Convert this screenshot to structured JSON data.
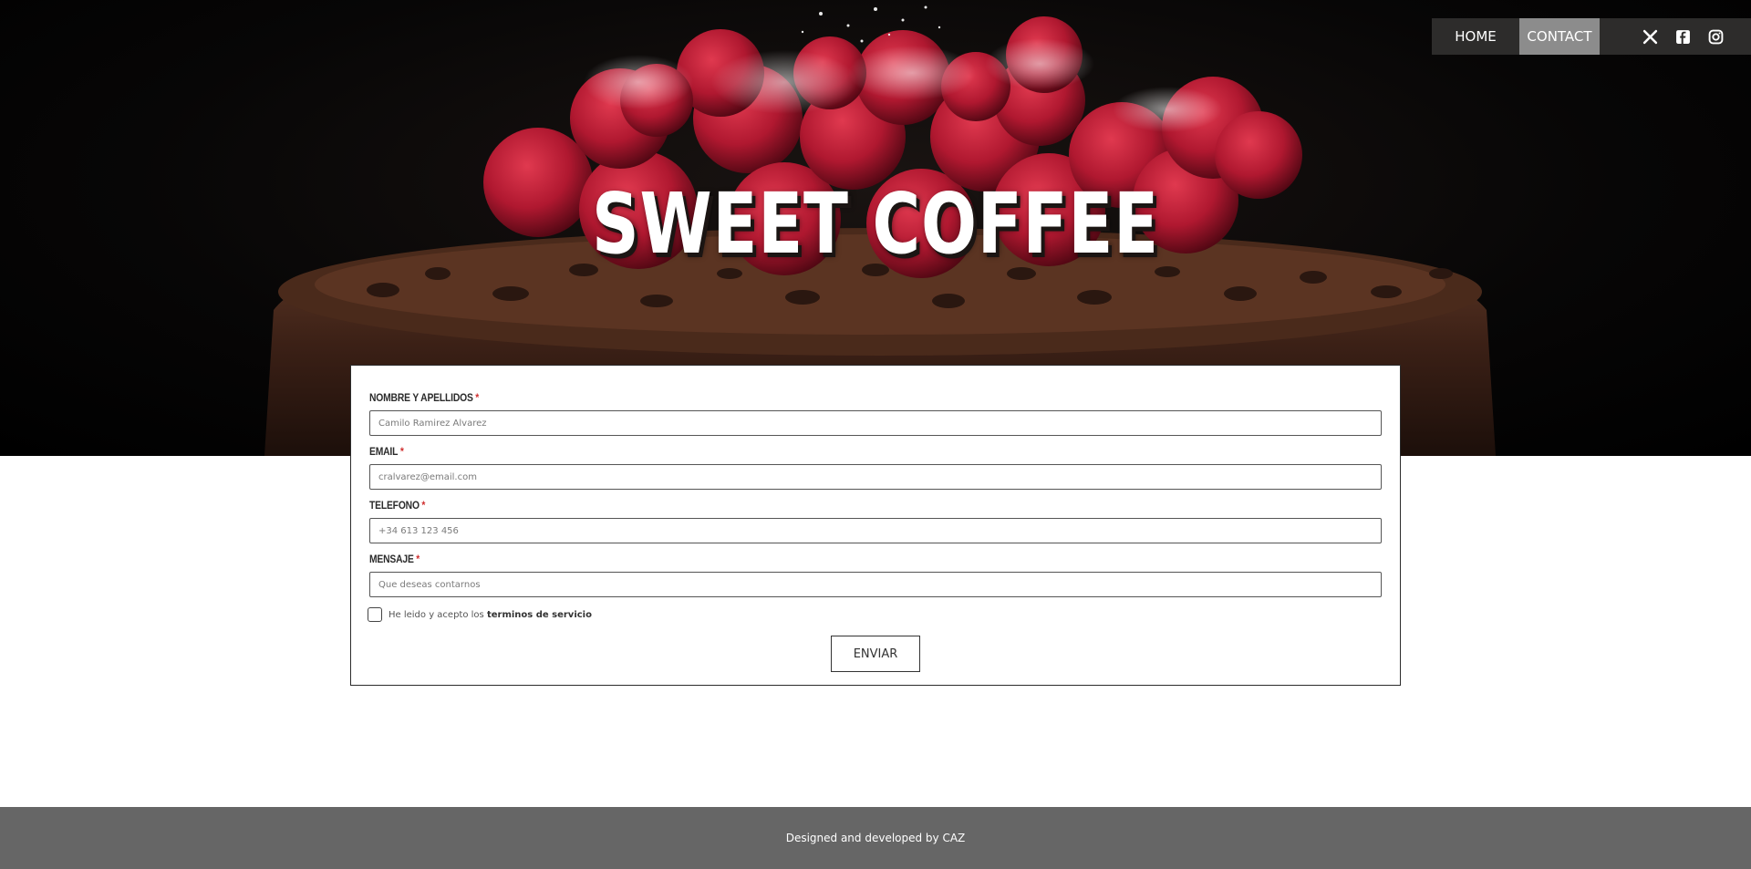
{
  "hero": {
    "title": "SWEET COFFEE"
  },
  "nav": {
    "items": [
      {
        "label": "HOME",
        "active": false
      },
      {
        "label": "CONTACT",
        "active": true
      }
    ],
    "social": [
      "x-twitter-icon",
      "facebook-icon",
      "instagram-icon"
    ]
  },
  "form": {
    "fields": [
      {
        "label": "NOMBRE Y APELLIDOS",
        "required_mark": "*",
        "placeholder": "Camilo Ramirez Alvarez"
      },
      {
        "label": "EMAIL",
        "required_mark": "*",
        "placeholder": "cralvarez@email.com"
      },
      {
        "label": "TELEFONO",
        "required_mark": "*",
        "placeholder": "+34 613 123 456"
      },
      {
        "label": "MENSAJE",
        "required_mark": "*",
        "placeholder": "Que deseas contarnos"
      }
    ],
    "terms_prefix": "He leido y acepto los",
    "terms_link": "terminos de servicio",
    "submit_label": "ENVIAR"
  },
  "footer": {
    "text": "Designed and developed by CAZ"
  },
  "colors": {
    "nav_bg": "#2d2c2b",
    "nav_active": "#8c8c8c",
    "footer_bg": "#666666",
    "required": "#d03030"
  }
}
